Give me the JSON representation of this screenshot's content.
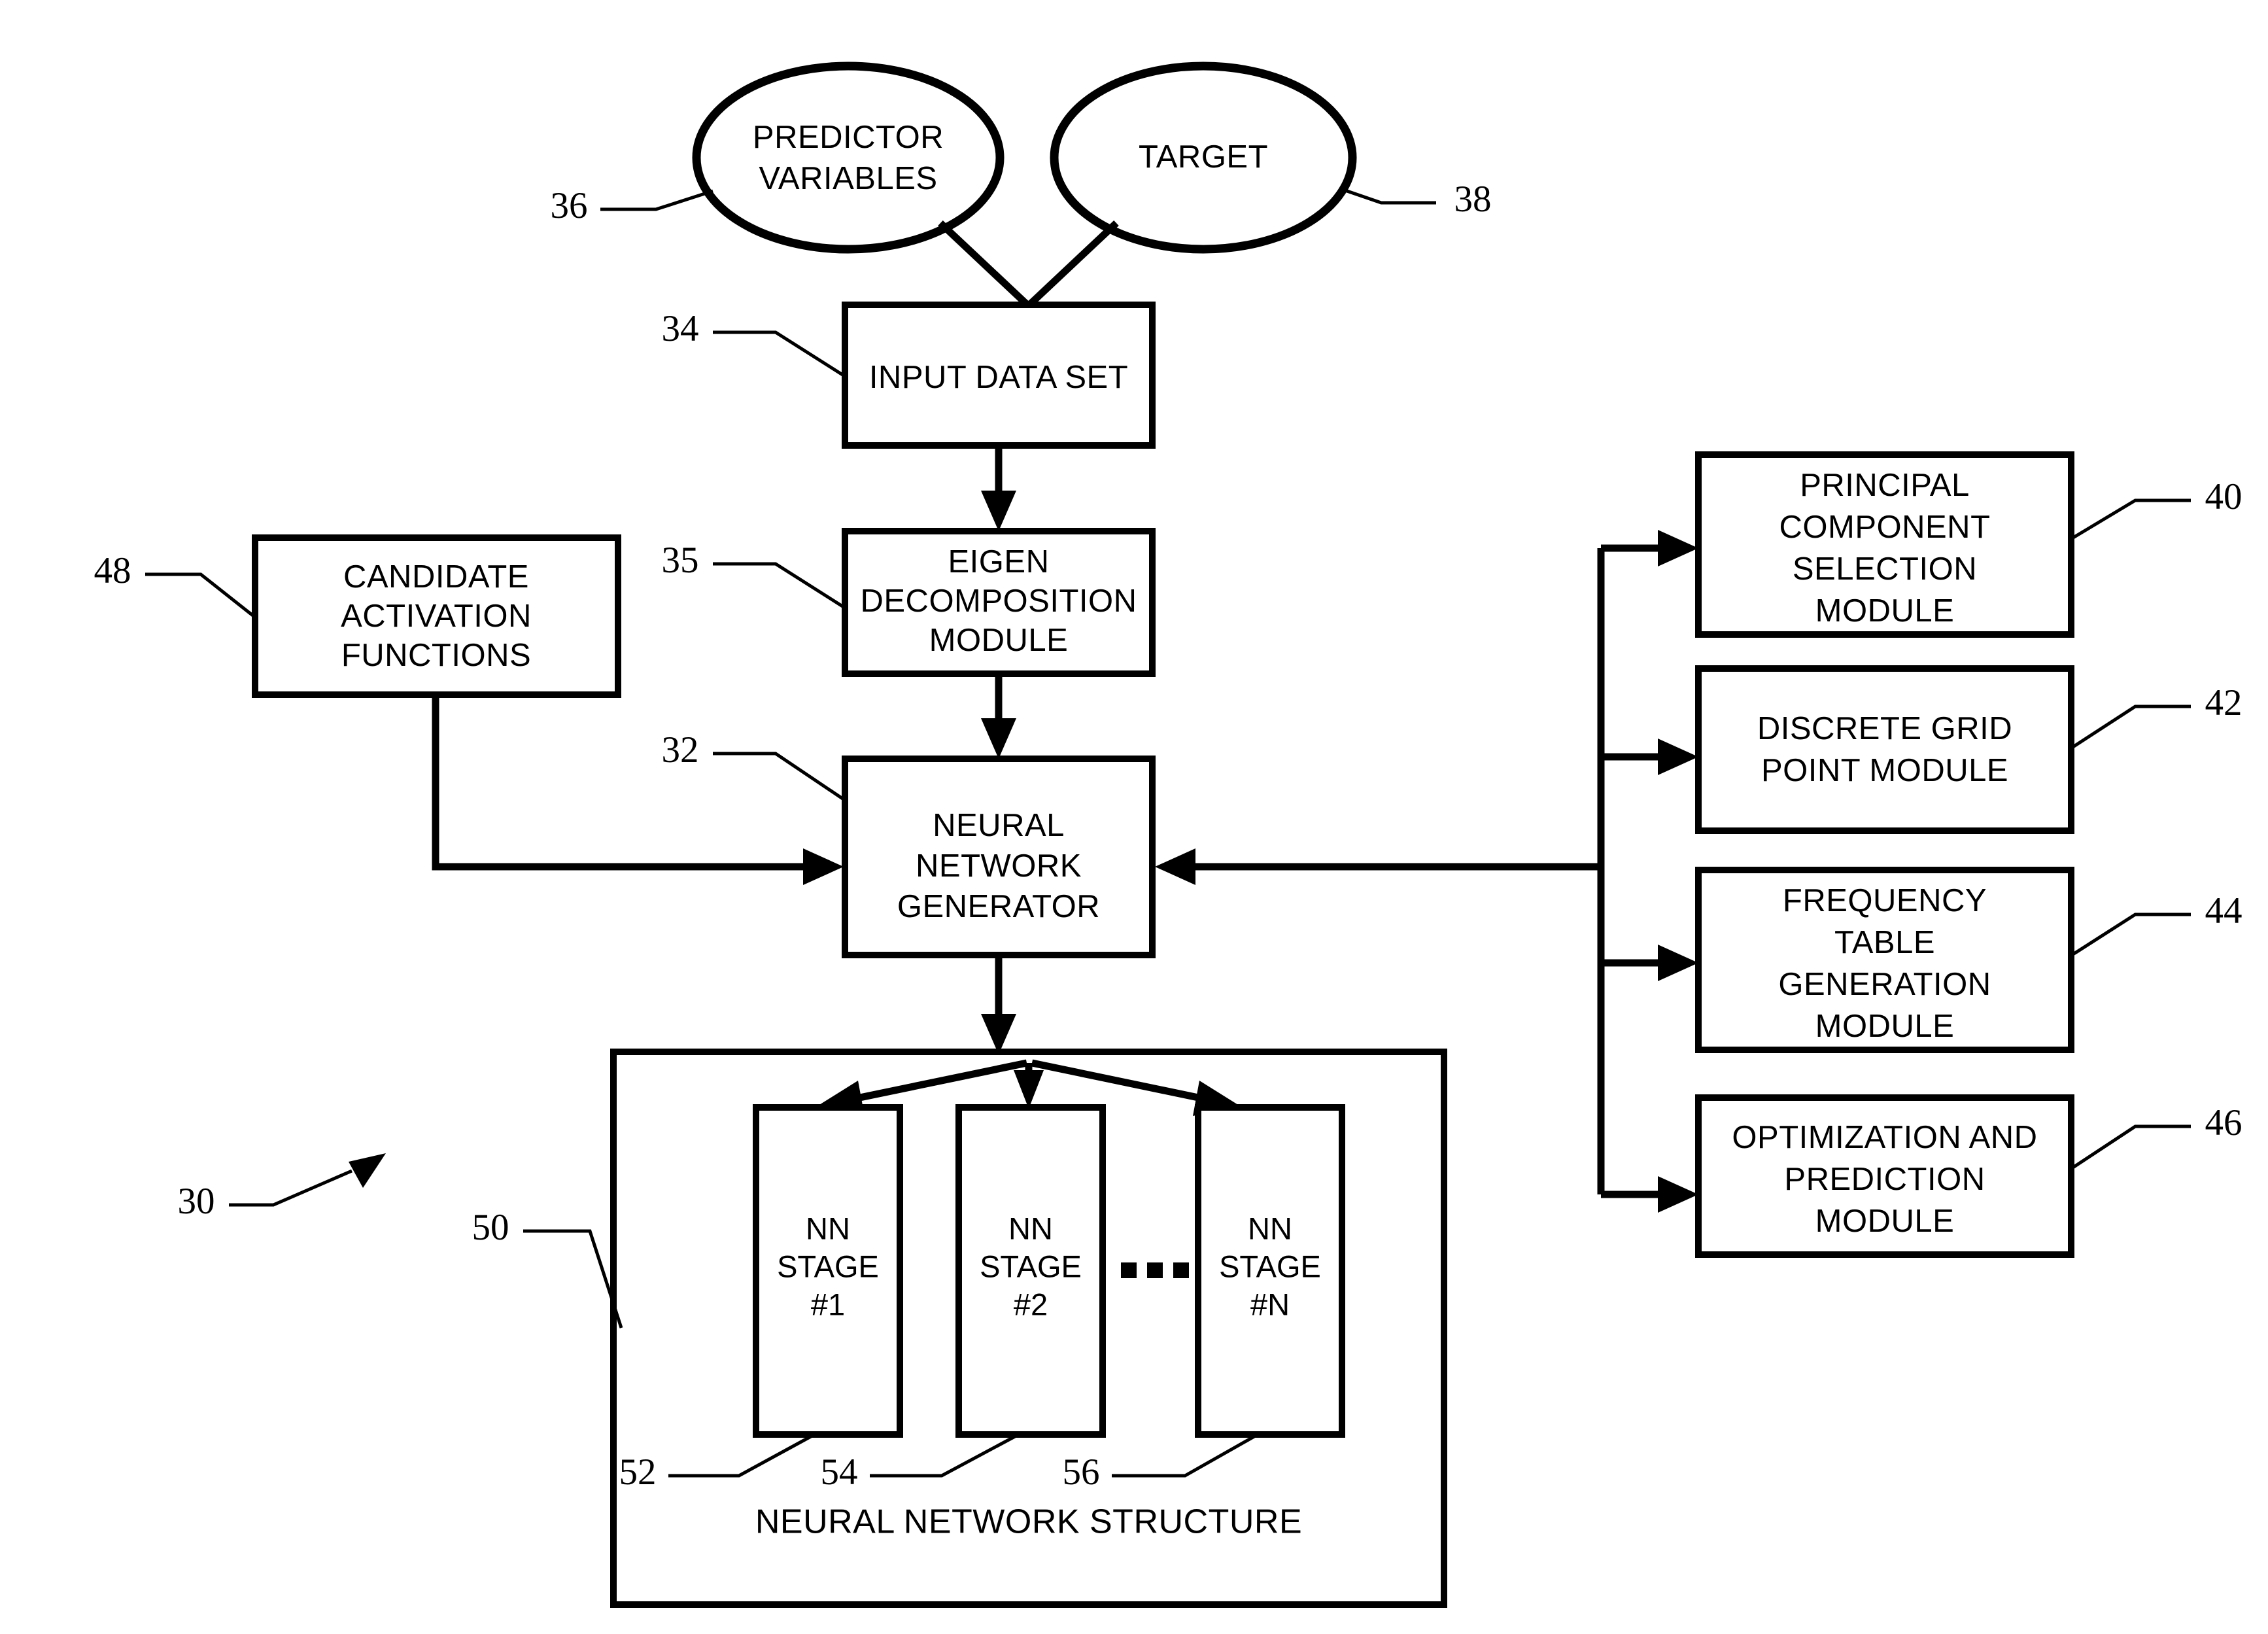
{
  "figure": {
    "type": "patent-block-diagram",
    "background_color": "#ffffff",
    "line_color": "#000000",
    "overall_reference": "30"
  },
  "nodes": {
    "predictor_variables": {
      "shape": "ellipse",
      "line1": "PREDICTOR",
      "line2": "VARIABLES",
      "reference": "36"
    },
    "target": {
      "shape": "ellipse",
      "line1": "TARGET",
      "reference": "38"
    },
    "input_data_set": {
      "shape": "rect",
      "line1": "INPUT DATA SET",
      "reference": "34"
    },
    "eigen_decomposition": {
      "shape": "rect",
      "line1": "EIGEN",
      "line2": "DECOMPOSITION",
      "line3": "MODULE",
      "reference": "35"
    },
    "neural_network_generator": {
      "shape": "rect",
      "line1": "NEURAL",
      "line2": "NETWORK",
      "line3": "GENERATOR",
      "reference": "32"
    },
    "candidate_activation_functions": {
      "shape": "rect",
      "line1": "CANDIDATE",
      "line2": "ACTIVATION",
      "line3": "FUNCTIONS",
      "reference": "48"
    },
    "principal_component_selection_module": {
      "shape": "rect",
      "line1": "PRINCIPAL",
      "line2": "COMPONENT",
      "line3": "SELECTION",
      "line4": "MODULE",
      "reference": "40"
    },
    "discrete_grid_point_module": {
      "shape": "rect",
      "line1": "DISCRETE GRID",
      "line2": "POINT MODULE",
      "reference": "42"
    },
    "frequency_table_generation_module": {
      "shape": "rect",
      "line1": "FREQUENCY",
      "line2": "TABLE",
      "line3": "GENERATION",
      "line4": "MODULE",
      "reference": "44"
    },
    "optimization_and_prediction_module": {
      "shape": "rect",
      "line1": "OPTIMIZATION AND",
      "line2": "PREDICTION",
      "line3": "MODULE",
      "reference": "46"
    },
    "neural_network_structure": {
      "shape": "rect",
      "caption": "NEURAL NETWORK STRUCTURE",
      "reference": "50"
    },
    "nn_stage_1": {
      "shape": "rect",
      "line1": "NN",
      "line2": "STAGE",
      "line3": "#1",
      "reference": "52"
    },
    "nn_stage_2": {
      "shape": "rect",
      "line1": "NN",
      "line2": "STAGE",
      "line3": "#2",
      "reference": "54"
    },
    "nn_stage_n": {
      "shape": "rect",
      "line1": "NN",
      "line2": "STAGE",
      "line3": "#N",
      "reference": "56"
    },
    "ellipsis_between_stages": {
      "symbol": "...",
      "glyph_count": 3
    }
  },
  "reference_numerals": [
    {
      "id": "ref-30",
      "value": "30"
    },
    {
      "id": "ref-32",
      "value": "32"
    },
    {
      "id": "ref-34",
      "value": "34"
    },
    {
      "id": "ref-35",
      "value": "35"
    },
    {
      "id": "ref-36",
      "value": "36"
    },
    {
      "id": "ref-38",
      "value": "38"
    },
    {
      "id": "ref-40",
      "value": "40"
    },
    {
      "id": "ref-42",
      "value": "42"
    },
    {
      "id": "ref-44",
      "value": "44"
    },
    {
      "id": "ref-46",
      "value": "46"
    },
    {
      "id": "ref-48",
      "value": "48"
    },
    {
      "id": "ref-50",
      "value": "50"
    },
    {
      "id": "ref-52",
      "value": "52"
    },
    {
      "id": "ref-54",
      "value": "54"
    },
    {
      "id": "ref-56",
      "value": "56"
    }
  ],
  "connections": [
    {
      "from": "predictor_variables",
      "to": "input_data_set",
      "style": "plain-line"
    },
    {
      "from": "target",
      "to": "input_data_set",
      "style": "plain-line"
    },
    {
      "from": "input_data_set",
      "to": "eigen_decomposition",
      "style": "arrow-down"
    },
    {
      "from": "eigen_decomposition",
      "to": "neural_network_generator",
      "style": "arrow-down"
    },
    {
      "from": "candidate_activation_functions",
      "to": "neural_network_generator",
      "style": "arrow-right"
    },
    {
      "from": "module_bus",
      "to": "neural_network_generator",
      "style": "arrow-left"
    },
    {
      "from": "module_bus",
      "to": "principal_component_selection_module",
      "style": "arrow-right"
    },
    {
      "from": "module_bus",
      "to": "discrete_grid_point_module",
      "style": "arrow-right"
    },
    {
      "from": "module_bus",
      "to": "frequency_table_generation_module",
      "style": "arrow-right"
    },
    {
      "from": "module_bus",
      "to": "optimization_and_prediction_module",
      "style": "arrow-right"
    },
    {
      "from": "neural_network_generator",
      "to": "neural_network_structure",
      "style": "arrow-down"
    },
    {
      "from": "fanout",
      "to": "nn_stage_1",
      "style": "arrow-diag-left"
    },
    {
      "from": "fanout",
      "to": "nn_stage_2",
      "style": "arrow-down"
    },
    {
      "from": "fanout",
      "to": "nn_stage_n",
      "style": "arrow-diag-right"
    }
  ]
}
